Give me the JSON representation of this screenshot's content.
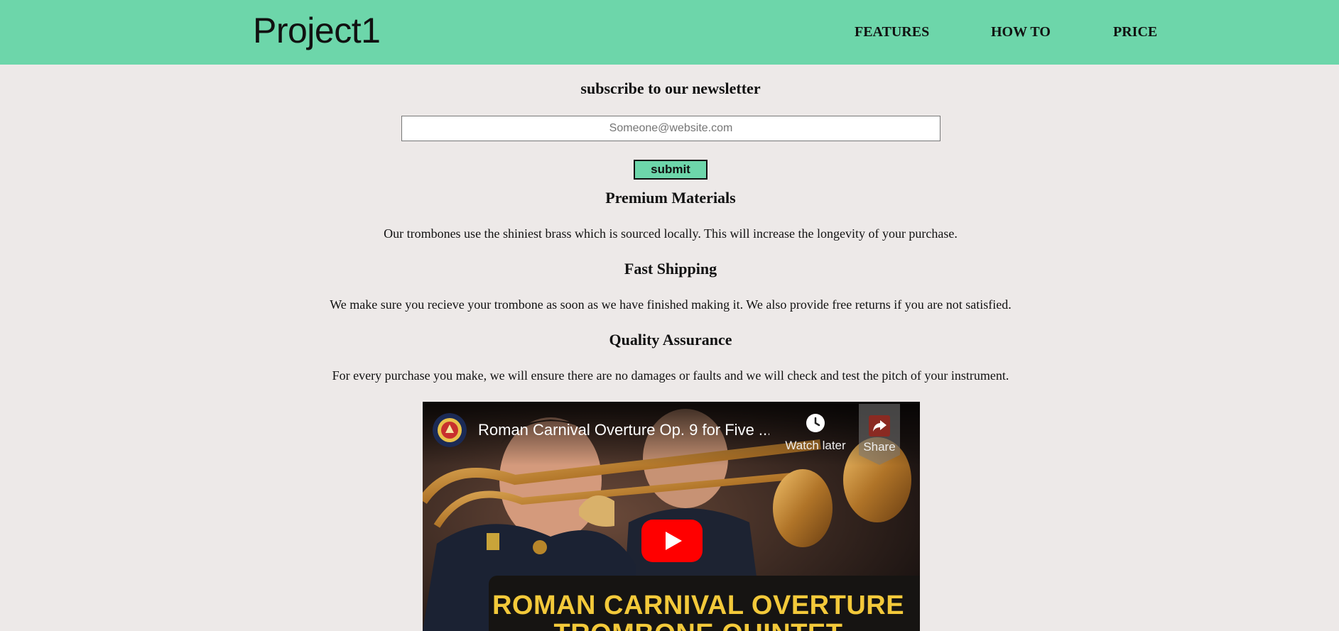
{
  "header": {
    "logo": "Project1",
    "nav": {
      "features": "FEATURES",
      "how_to": "HOW TO",
      "price": "PRICE"
    }
  },
  "newsletter": {
    "title": "subscribe to our newsletter",
    "email_placeholder": "Someone@website.com",
    "submit_label": "submit"
  },
  "features": [
    {
      "heading": "Premium Materials",
      "text": "Our trombones use the shiniest brass which is sourced locally. This will increase the longevity of your purchase."
    },
    {
      "heading": "Fast Shipping",
      "text": "We make sure you recieve your trombone as soon as we have finished making it. We also provide free returns if you are not satisfied."
    },
    {
      "heading": "Quality Assurance",
      "text": "For every purchase you make, we will ensure there are no damages or faults and we will check and test the pitch of your instrument."
    }
  ],
  "video": {
    "title": "Roman Carnival Overture Op. 9 for Five ...",
    "watch_later_label": "Watch later",
    "share_label": "Share",
    "banner_line1": "ROMAN CARNIVAL OVERTURE",
    "banner_line2": "TROMBONE QUINTET"
  },
  "colors": {
    "header_bg": "#6dd6aa",
    "page_bg": "#ede9e8",
    "button_bg": "#6dd6aa",
    "youtube_red": "#ff0000",
    "banner_text": "#f3c93a"
  }
}
